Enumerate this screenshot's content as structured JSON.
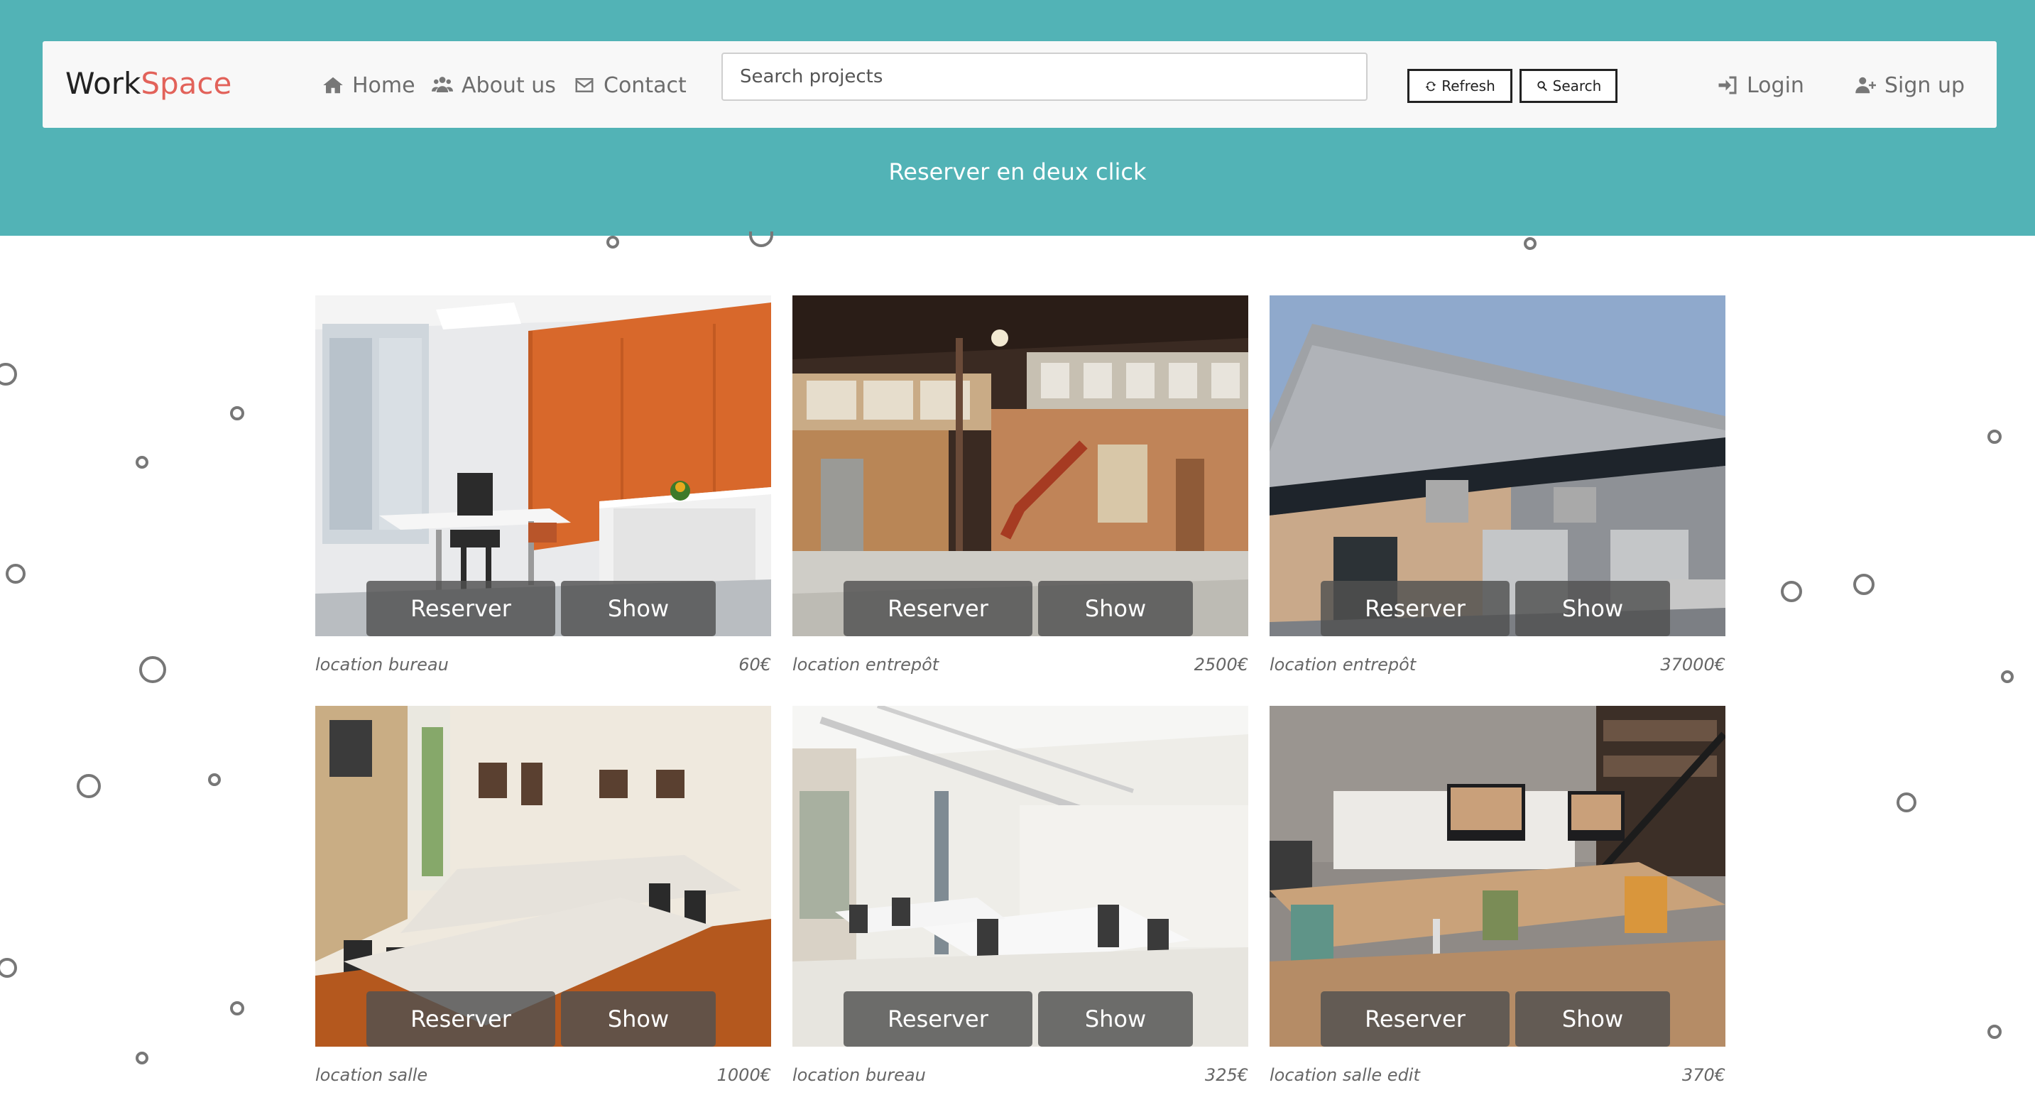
{
  "colors": {
    "header_bg": "#52b3b6",
    "navbar_bg": "#f8f8f8",
    "brand_accent": "#e2625a",
    "button_overlay": "#505050"
  },
  "brand": {
    "part1": "Work",
    "part2": "Space"
  },
  "nav": {
    "home": {
      "icon": "home-icon",
      "label": "Home"
    },
    "about": {
      "icon": "users-icon",
      "label": "About us"
    },
    "contact": {
      "icon": "envelope-icon",
      "label": "Contact"
    }
  },
  "search": {
    "placeholder": "Search projects",
    "refresh_icon": "refresh-icon",
    "refresh_label": "Refresh",
    "search_icon": "search-icon",
    "search_label": "Search"
  },
  "auth": {
    "login": {
      "icon": "sign-in-icon",
      "label": "Login"
    },
    "signup": {
      "icon": "user-plus-icon",
      "label": "Sign up"
    }
  },
  "tagline": "Reserver en deux click",
  "listings": [
    {
      "title": "location bureau",
      "price": "60€",
      "reserve_label": "Reserver",
      "show_label": "Show",
      "photo": "orange-office-photo"
    },
    {
      "title": "location entrepôt",
      "price": "2500€",
      "reserve_label": "Reserver",
      "show_label": "Show",
      "photo": "warehouse-interior-photo"
    },
    {
      "title": "location entrepôt",
      "price": "37000€",
      "reserve_label": "Reserver",
      "show_label": "Show",
      "photo": "warehouse-exterior-photo"
    },
    {
      "title": "location salle",
      "price": "1000€",
      "reserve_label": "Reserver",
      "show_label": "Show",
      "photo": "meeting-room-photo"
    },
    {
      "title": "location bureau",
      "price": "325€",
      "reserve_label": "Reserver",
      "show_label": "Show",
      "photo": "open-office-photo"
    },
    {
      "title": "location salle edit",
      "price": "370€",
      "reserve_label": "Reserver",
      "show_label": "Show",
      "photo": "coworking-desks-photo"
    }
  ]
}
